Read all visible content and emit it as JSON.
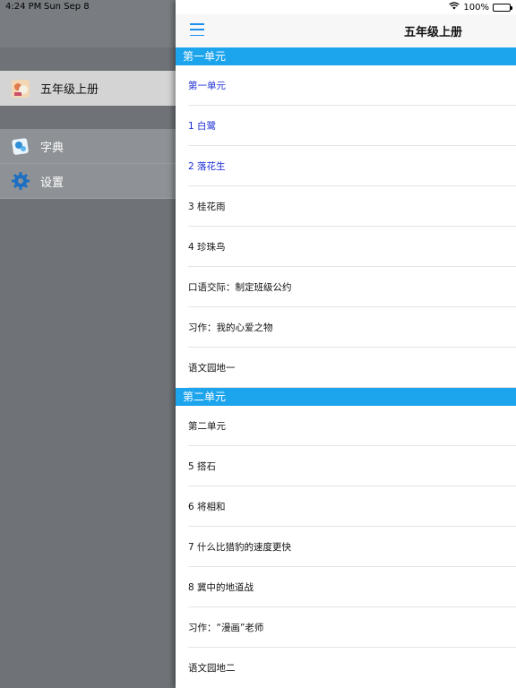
{
  "status_bar": {
    "time": "4:24 PM",
    "date": "Sun Sep 8",
    "battery": "100%"
  },
  "sidebar": {
    "selected_item": {
      "label": "五年级上册",
      "icon": "book-cover-icon"
    },
    "tools": [
      {
        "label": "字典",
        "icon": "dictionary-icon"
      },
      {
        "label": "设置",
        "icon": "gear-icon"
      }
    ]
  },
  "navbar": {
    "title": "五年级上册",
    "menu_icon": "hamburger-menu-icon"
  },
  "colors": {
    "accent": "#1ca4ed",
    "active_text": "#1a2cd6"
  },
  "sections": [
    {
      "title": "第一单元",
      "items": [
        {
          "label": "第一单元",
          "active": true
        },
        {
          "label": "1 白鹭",
          "active": true
        },
        {
          "label": "2 落花生",
          "active": true
        },
        {
          "label": "3 桂花雨",
          "active": false
        },
        {
          "label": "4 珍珠鸟",
          "active": false
        },
        {
          "label": "口语交际：制定班级公约",
          "active": false
        },
        {
          "label": "习作：我的心爱之物",
          "active": false
        },
        {
          "label": "语文园地一",
          "active": false
        }
      ]
    },
    {
      "title": "第二单元",
      "items": [
        {
          "label": "第二单元",
          "active": false
        },
        {
          "label": "5 搭石",
          "active": false
        },
        {
          "label": "6 将相和",
          "active": false
        },
        {
          "label": "7 什么比猎豹的速度更快",
          "active": false
        },
        {
          "label": "8 冀中的地道战",
          "active": false
        },
        {
          "label": "习作：“漫画”老师",
          "active": false
        },
        {
          "label": "语文园地二",
          "active": false
        }
      ]
    }
  ]
}
